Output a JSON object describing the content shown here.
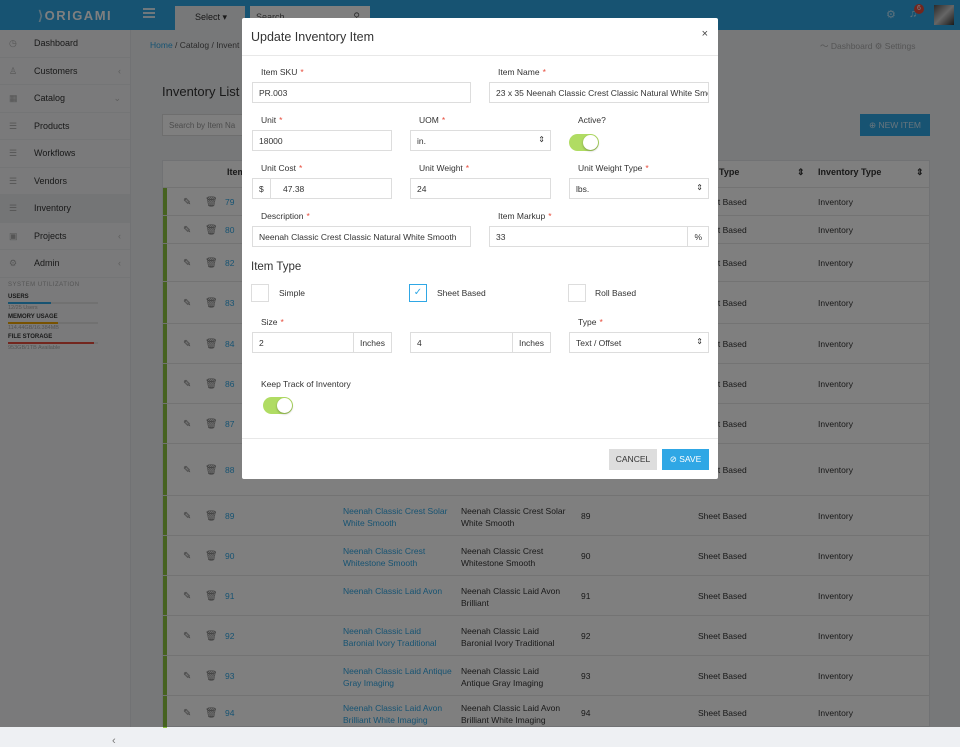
{
  "topbar": {
    "logo": "ORIGAMI",
    "select_label": "Select ▾",
    "search_placeholder": "Search",
    "notif_count": "6",
    "icons": [
      "hamburger-icon",
      "search-icon",
      "gear-icon",
      "bell-icon"
    ]
  },
  "sidebar": {
    "items": [
      {
        "label": "Dashboard",
        "icon": "clock-icon",
        "chev": ""
      },
      {
        "label": "Customers",
        "icon": "user-icon",
        "chev": "‹"
      },
      {
        "label": "Catalog",
        "icon": "grid-icon",
        "chev": "⌄"
      },
      {
        "label": "Products",
        "icon": "list-icon",
        "chev": ""
      },
      {
        "label": "Workflows",
        "icon": "list-icon",
        "chev": ""
      },
      {
        "label": "Vendors",
        "icon": "list-icon",
        "chev": ""
      },
      {
        "label": "Inventory",
        "icon": "list-icon",
        "chev": ""
      },
      {
        "label": "Projects",
        "icon": "briefcase-icon",
        "chev": "‹"
      },
      {
        "label": "Admin",
        "icon": "gear-icon",
        "chev": "‹"
      }
    ],
    "util": {
      "header": "SYSTEM UTILIZATION",
      "users_label": "USERS",
      "users_val": "12/25 Users",
      "users_pct": 0.48,
      "mem_label": "MEMORY USAGE",
      "mem_val": "114.44GB/16.384MB",
      "mem_pct": 0.55,
      "file_label": "FILE STORAGE",
      "file_val": "953GB/1TB Available",
      "file_pct": 0.95,
      "colors": {
        "users": "#2fa7e5",
        "mem": "#f0a500",
        "file": "#e74c3c"
      }
    }
  },
  "breadcrumb": {
    "home": "Home",
    "catalog": "Catalog",
    "current": "Invent"
  },
  "top_links": "〜 Dashboard   ⚙ Settings",
  "main": {
    "title": "Inventory List",
    "search_placeholder": "Search by Item Na",
    "new_item": "⊕  NEW ITEM",
    "headers": {
      "item": "Item",
      "type": "Type",
      "inv": "Inventory Type"
    },
    "rows": [
      {
        "num": "79",
        "name": "",
        "desc": "",
        "qty": "",
        "type": "Sheet Based",
        "inv": "Inventory"
      },
      {
        "num": "80",
        "name": "",
        "desc": "",
        "qty": "",
        "type": "Sheet Based",
        "inv": "Inventory"
      },
      {
        "num": "82",
        "name": "",
        "desc": "",
        "qty": "",
        "type": "Sheet Based",
        "inv": "Inventory"
      },
      {
        "num": "83",
        "name": "",
        "desc": "",
        "qty": "",
        "type": "Sheet Based",
        "inv": "Inventory"
      },
      {
        "num": "84",
        "name": "",
        "desc": "",
        "qty": "",
        "type": "Sheet Based",
        "inv": "Inventory"
      },
      {
        "num": "86",
        "name": "",
        "desc": "",
        "qty": "",
        "type": "Sheet Based",
        "inv": "Inventory"
      },
      {
        "num": "87",
        "name": "",
        "desc": "",
        "qty": "",
        "type": "Sheet Based",
        "inv": "Inventory"
      },
      {
        "num": "88",
        "name": "Smooth",
        "desc": "Smooth",
        "qty": "",
        "type": "Sheet Based",
        "inv": "Inventory"
      },
      {
        "num": "89",
        "name": "Neenah Classic Crest Solar White Smooth",
        "desc": "Neenah Classic Crest Solar White Smooth",
        "qty": "89",
        "type": "Sheet Based",
        "inv": "Inventory"
      },
      {
        "num": "90",
        "name": "Neenah Classic Crest Whitestone Smooth",
        "desc": "Neenah Classic Crest Whitestone Smooth",
        "qty": "90",
        "type": "Sheet Based",
        "inv": "Inventory"
      },
      {
        "num": "91",
        "name": "Neenah Classic Laid Avon",
        "desc": "Neenah Classic Laid Avon Brilliant",
        "qty": "91",
        "type": "Sheet Based",
        "inv": "Inventory"
      },
      {
        "num": "92",
        "name": "Neenah Classic Laid Baronial Ivory Traditional",
        "desc": "Neenah Classic Laid Baronial Ivory Traditional",
        "qty": "92",
        "type": "Sheet Based",
        "inv": "Inventory"
      },
      {
        "num": "93",
        "name": "Neenah Classic Laid Antique Gray Imaging",
        "desc": "Neenah Classic Laid Antique Gray Imaging",
        "qty": "93",
        "type": "Sheet Based",
        "inv": "Inventory"
      },
      {
        "num": "94",
        "name": "Neenah Classic Laid Avon Brilliant White Imaging",
        "desc": "Neenah Classic Laid Avon Brilliant White Imaging",
        "qty": "94",
        "type": "Sheet Based",
        "inv": "Inventory"
      }
    ]
  },
  "modal": {
    "title": "Update Inventory Item",
    "close": "×",
    "sku_label": "Item SKU",
    "sku": "PR.003",
    "name_label": "Item Name",
    "name": "23 x 35 Neenah Classic Crest Classic Natural White Smooth",
    "unit_label": "Unit",
    "unit": "18000",
    "uom_label": "UOM",
    "uom": "in.",
    "active_label": "Active?",
    "cost_label": "Unit Cost",
    "cost_prefix": "$",
    "cost": "47.38",
    "weight_label": "Unit Weight",
    "weight": "24",
    "wtype_label": "Unit Weight Type",
    "wtype": "lbs.",
    "desc_label": "Description",
    "desc": "Neenah Classic Crest Classic Natural White Smooth",
    "markup_label": "Item Markup",
    "markup": "33",
    "markup_suffix": "%",
    "section": "Item Type",
    "opt_simple": "Simple",
    "opt_sheet": "Sheet Based",
    "opt_roll": "Roll Based",
    "size_label": "Size",
    "size_w": "2",
    "size_w_unit": "Inches",
    "size_h": "4",
    "size_h_unit": "Inches",
    "type_label": "Type",
    "type": "Text / Offset",
    "track_label": "Keep Track of Inventory",
    "cancel": "CANCEL",
    "save": "⊘ SAVE"
  }
}
